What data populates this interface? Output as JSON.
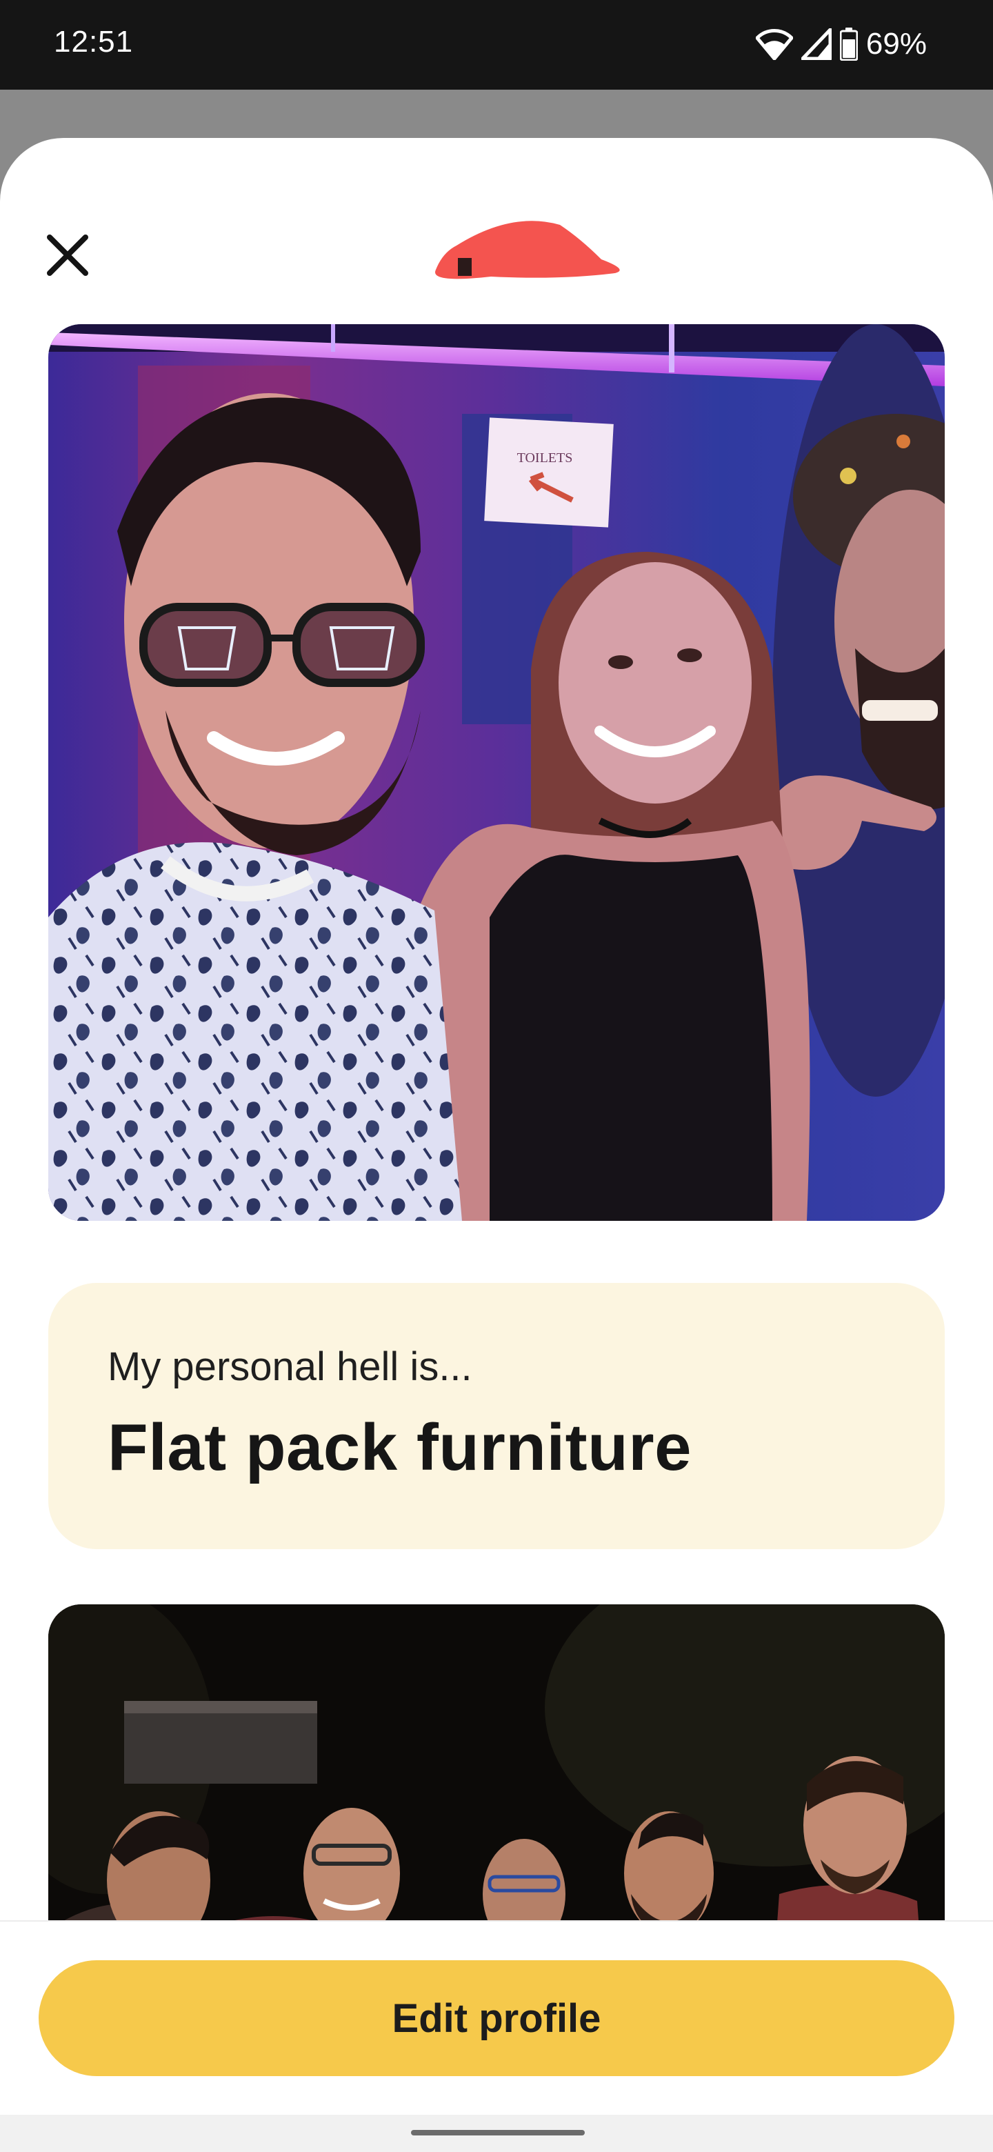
{
  "status_bar": {
    "time": "12:51",
    "battery": "69%",
    "icons": [
      "wifi-icon",
      "cell-signal-icon",
      "battery-icon"
    ]
  },
  "header": {
    "close_icon": "close-icon",
    "profile_name_redacted": true
  },
  "content": {
    "photos": [
      {
        "description_icon": "group-selfie-photo",
        "sign_text": "TOILETS"
      },
      {
        "description_icon": "group-night-photo"
      }
    ],
    "prompt": {
      "question": "My personal hell is...",
      "answer": "Flat pack furniture"
    }
  },
  "footer": {
    "edit_profile_label": "Edit profile"
  },
  "colors": {
    "accent": "#f6c94b",
    "prompt_bg": "#fcf5e0",
    "redaction": "#f4544f"
  }
}
